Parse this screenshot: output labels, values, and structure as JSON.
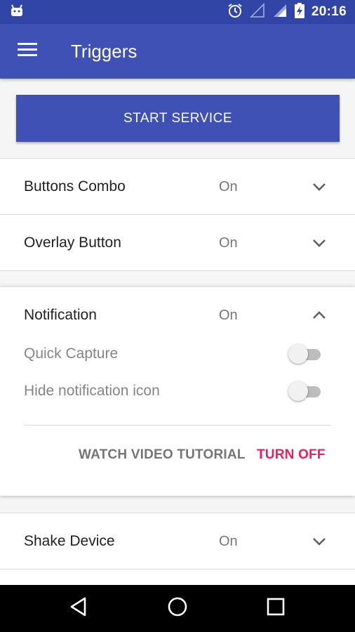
{
  "status_bar": {
    "time": "20:16",
    "icons": [
      "android-icon",
      "alarm-icon",
      "signal-empty-icon",
      "signal-icon",
      "battery-charging-icon"
    ]
  },
  "app_bar": {
    "title": "Triggers",
    "menu_icon": "menu-icon"
  },
  "start_service": {
    "label": "START SERVICE"
  },
  "triggers": [
    {
      "title": "Buttons Combo",
      "status": "On",
      "expanded": false
    },
    {
      "title": "Overlay Button",
      "status": "On",
      "expanded": false
    },
    {
      "title": "Notification",
      "status": "On",
      "expanded": true,
      "options": [
        {
          "label": "Quick Capture",
          "enabled": false
        },
        {
          "label": "Hide notification icon",
          "enabled": false
        }
      ],
      "actions": {
        "tutorial": "WATCH VIDEO TUTORIAL",
        "turn_off": "TURN OFF"
      }
    },
    {
      "title": "Shake Device",
      "status": "On",
      "expanded": false
    }
  ],
  "colors": {
    "primary": "#3f51b5",
    "status_bar": "#3045a5",
    "accent": "#e91e63"
  },
  "nav_bar": {
    "icons": [
      "back-icon",
      "home-icon",
      "recents-icon"
    ]
  }
}
